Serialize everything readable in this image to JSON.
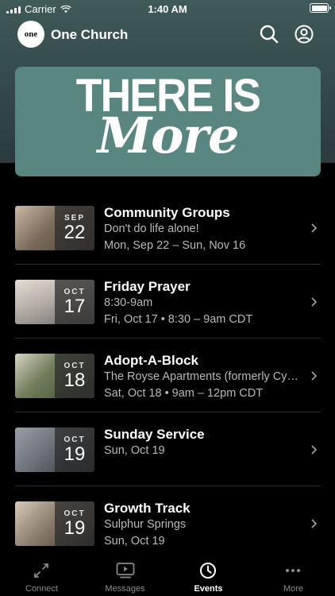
{
  "status_bar": {
    "carrier": "Carrier",
    "time": "1:40 AM",
    "battery_level": 1.0
  },
  "header": {
    "logo_text": "one",
    "title": "One Church",
    "icons": [
      "search-icon",
      "account-icon"
    ]
  },
  "banner": {
    "line1": "THERE IS",
    "line2": "More"
  },
  "events": [
    {
      "month": "SEP",
      "day": "22",
      "title": "Community Groups",
      "line1": "Don't do life alone!",
      "line2": "Mon, Sep 22 – Sun, Nov 16",
      "thumb_color": "#7a6a5c"
    },
    {
      "month": "OCT",
      "day": "17",
      "title": "Friday Prayer",
      "line1": "8:30-9am",
      "line2": "Fri, Oct 17 • 8:30 – 9am CDT",
      "thumb_color": "#b9b3ab"
    },
    {
      "month": "OCT",
      "day": "18",
      "title": "Adopt-A-Block",
      "line1": "The Royse Apartments (formerly Cypress...",
      "line2": "Sat, Oct 18 • 9am – 12pm CDT",
      "thumb_color": "#6f7e5a"
    },
    {
      "month": "OCT",
      "day": "19",
      "title": "Sunday Service",
      "line1": "Sun, Oct 19",
      "line2": "",
      "thumb_color": "#6a6f78"
    },
    {
      "month": "OCT",
      "day": "19",
      "title": "Growth Track",
      "line1": "Sulphur Springs",
      "line2": "Sun, Oct 19",
      "thumb_color": "#8a7c6e"
    }
  ],
  "tabs": [
    {
      "label": "Connect",
      "icon": "connect-icon",
      "active": false
    },
    {
      "label": "Messages",
      "icon": "messages-icon",
      "active": false
    },
    {
      "label": "Events",
      "icon": "clock-icon",
      "active": true
    },
    {
      "label": "More",
      "icon": "more-icon",
      "active": false
    }
  ],
  "colors": {
    "header_bg": "#3f5a58",
    "banner_bg": "#5a8682",
    "background": "#000000",
    "inactive_tab": "#8a8a8a"
  }
}
